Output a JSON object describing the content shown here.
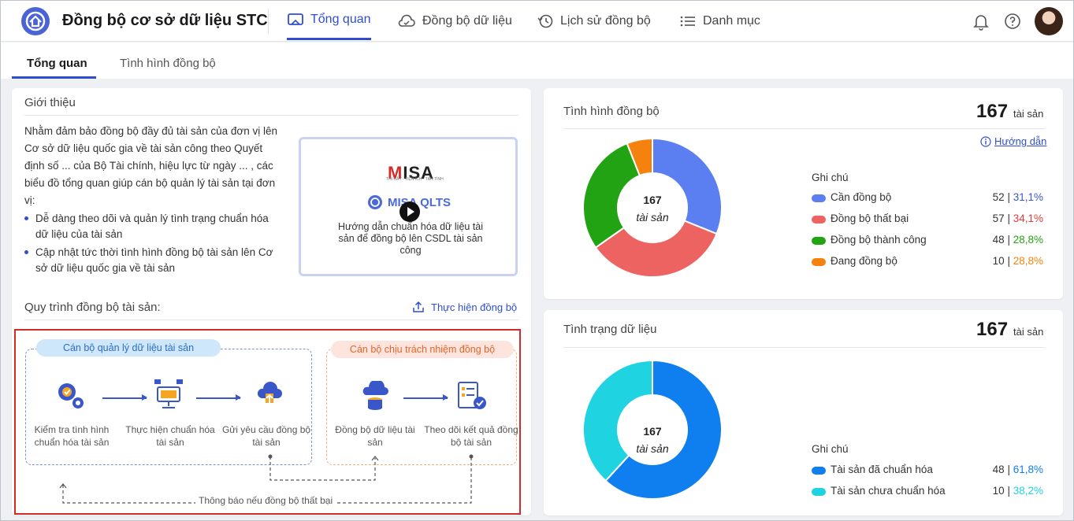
{
  "app": {
    "title": "Đồng bộ cơ sở dữ liệu STC"
  },
  "nav": [
    {
      "label": "Tổng quan",
      "icon": "monitor-icon",
      "active": true
    },
    {
      "label": "Đồng bộ dữ liệu",
      "icon": "cloud-sync-icon"
    },
    {
      "label": "Lịch sử đồng bộ",
      "icon": "history-icon"
    },
    {
      "label": "Danh mục",
      "icon": "list-icon"
    }
  ],
  "subtabs": [
    "Tổng quan",
    "Tình hình đồng bộ"
  ],
  "intro": {
    "title": "Giới thiệu",
    "paragraph": "Nhằm đảm bảo đồng bộ đầy đủ tài sản của đơn vị lên Cơ sở dữ liệu quốc gia về tài sản công theo Quyết định số ... của Bộ Tài chính, hiệu lực từ ngày ... , các biểu đồ tổng quan giúp cán bộ quản lý tài sản tại đơn vị:",
    "bullets": [
      "Dễ dàng theo dõi và quản lý tình trạng chuẩn hóa dữ liệu của tài sản",
      "Cập nhật tức thời tình hình đồng bộ tài sản lên Cơ sở dữ liệu quốc gia về tài sản"
    ],
    "video": {
      "brand": "MISA",
      "brand_sub": "TIN CẬY · TIỆN ÍCH · TẬN TÌNH",
      "product": "MISA QLTS",
      "caption": "Hướng dẫn chuẩn hóa dữ liệu tài sản để đồng bộ lên CSDL tài sản công"
    }
  },
  "process": {
    "title": "Quy trình đồng bộ tài sản:",
    "action": "Thực hiện đồng bộ",
    "group_a": "Cán bộ quản lý dữ liệu tài sản",
    "group_b": "Cán bộ chịu trách nhiệm đồng bộ",
    "steps": [
      "Kiểm tra tình hình chuẩn hóa tài sản",
      "Thực hiện chuẩn hóa tài sản",
      "Gửi yêu cầu đồng bộ tài sản",
      "Đồng bộ dữ liệu tài sản",
      "Theo dõi kết quả đồng bộ tài sản"
    ],
    "notify": "Thông báo nếu đồng bộ thất bại"
  },
  "sync_status": {
    "title": "Tình hình đồng bộ",
    "total": "167",
    "unit": "tài sản",
    "guide": "Hướng dẫn",
    "legend_title": "Ghi chú",
    "center_value": "167",
    "center_unit": "tài sản",
    "items": [
      {
        "name": "Cần đồng bộ",
        "count": "52",
        "pct": "31,1%",
        "color": "#5b7ef0",
        "pct_color": "#3a57c9"
      },
      {
        "name": "Đồng bộ thất bại",
        "count": "57",
        "pct": "34,1%",
        "color": "#ec6361",
        "pct_color": "#e03c3c"
      },
      {
        "name": "Đồng bộ thành công",
        "count": "48",
        "pct": "28,8%",
        "color": "#22a313",
        "pct_color": "#22a313"
      },
      {
        "name": "Đang đồng bộ",
        "count": "10",
        "pct": "28,8%",
        "color": "#f5820f",
        "pct_color": "#f5820f"
      }
    ]
  },
  "data_status": {
    "title": "Tình trạng dữ liệu",
    "total": "167",
    "unit": "tài sản",
    "legend_title": "Ghi chú",
    "center_value": "167",
    "center_unit": "tài sản",
    "items": [
      {
        "name": "Tài sản đã chuẩn hóa",
        "count": "48",
        "pct": "61,8%",
        "color": "#0f7ff0",
        "pct_color": "#0f7ff0"
      },
      {
        "name": "Tài sản chưa chuẩn hóa",
        "count": "10",
        "pct": "38,2%",
        "color": "#1fd3e0",
        "pct_color": "#1fd3e0"
      }
    ]
  },
  "chart_data": [
    {
      "type": "pie",
      "title": "Tình hình đồng bộ",
      "categories": [
        "Cần đồng bộ",
        "Đồng bộ thất bại",
        "Đồng bộ thành công",
        "Đang đồng bộ"
      ],
      "values": [
        52,
        57,
        48,
        10
      ]
    },
    {
      "type": "pie",
      "title": "Tình trạng dữ liệu",
      "categories": [
        "Tài sản đã chuẩn hóa",
        "Tài sản chưa chuẩn hóa"
      ],
      "values": [
        61.8,
        38.2
      ]
    }
  ]
}
